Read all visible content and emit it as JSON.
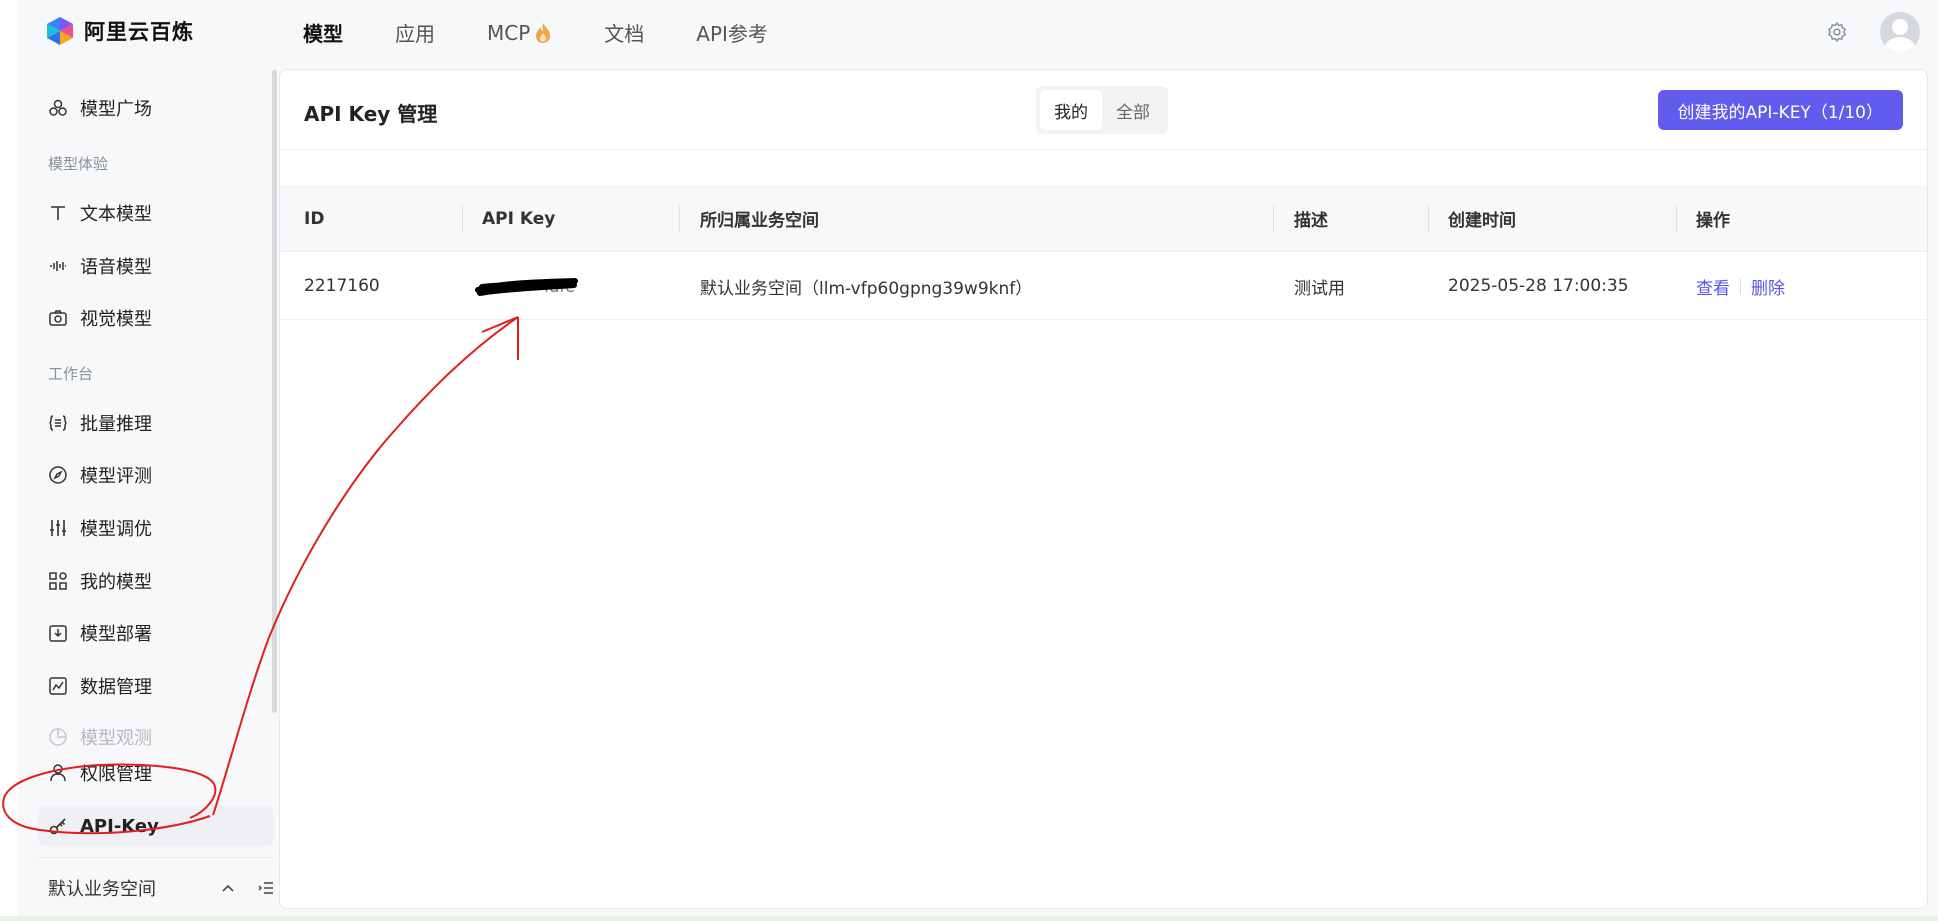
{
  "app": {
    "title": "阿里云百炼"
  },
  "nav": {
    "items": [
      {
        "label": "模型",
        "active": true
      },
      {
        "label": "应用",
        "active": false
      },
      {
        "label": "MCP",
        "active": false,
        "icon": "fire-icon"
      },
      {
        "label": "文档",
        "active": false
      },
      {
        "label": "API参考",
        "active": false
      }
    ]
  },
  "sidebar": {
    "square": "模型广场",
    "group_experience": "模型体验",
    "text_model": "文本模型",
    "audio_model": "语音模型",
    "vision_model": "视觉模型",
    "group_workbench": "工作台",
    "batch": "批量推理",
    "eval": "模型评测",
    "tune": "模型调优",
    "my_models": "我的模型",
    "deploy": "模型部署",
    "data": "数据管理",
    "observe": "模型观测",
    "permission": "权限管理",
    "api_key": "API-Key",
    "workspace": "默认业务空间"
  },
  "panel": {
    "title": "API Key 管理",
    "seg_mine": "我的",
    "seg_all": "全部",
    "create": "创建我的API-KEY（1/10）"
  },
  "table": {
    "headers": {
      "id": "ID",
      "api_key": "API Key",
      "workspace": "所归属业务空间",
      "desc": "描述",
      "created": "创建时间",
      "ops": "操作"
    },
    "rows": [
      {
        "id": "2217160",
        "api_key_suffix": "fafe",
        "workspace": "默认业务空间（llm-vfp60gpng39w9knf）",
        "desc": "测试用",
        "created": "2025-05-28 17:00:35",
        "view": "查看",
        "delete": "删除"
      }
    ]
  },
  "colors": {
    "accent": "#615ced",
    "link": "#5a55e6",
    "annotation": "#e0201b"
  }
}
